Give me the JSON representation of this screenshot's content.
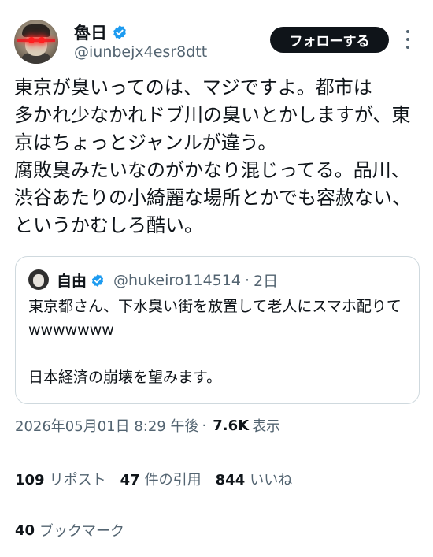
{
  "author": {
    "name": "魯日",
    "handle": "@iunbejx4esr8dtt",
    "follow_label": "フォローする"
  },
  "tweet": {
    "text": "東京が臭いってのは、マジですよ。都市は\n多かれ少なかれドブ川の臭いとかしますが、東京はちょっとジャンルが違う。\n腐敗臭みたいなのがかなり混じってる。品川、渋谷あたりの小綺麗な場所とかでも容赦ない、というかむしろ酷い。"
  },
  "quote": {
    "name": "自由",
    "handle": "@hukeiro114514",
    "dot": "·",
    "date": "2日",
    "text": "東京都さん、下水臭い街を放置して老人にスマホ配りてwwwwwww\n\n日本経済の崩壊を望みます。"
  },
  "meta": {
    "timestamp": "2026年05月01日 8:29 午後",
    "dot": "·",
    "views": "7.6K",
    "views_label": "表示"
  },
  "stats": {
    "reposts_count": "109",
    "reposts_label": "リポスト",
    "quotes_count": "47",
    "quotes_label": "件の引用",
    "likes_count": "844",
    "likes_label": "いいね",
    "bookmarks_count": "40",
    "bookmarks_label": "ブックマーク"
  },
  "colors": {
    "text_primary": "#0f1419",
    "text_secondary": "#536471",
    "verified_blue": "#1d9bf0",
    "border": "#cfd9de"
  }
}
